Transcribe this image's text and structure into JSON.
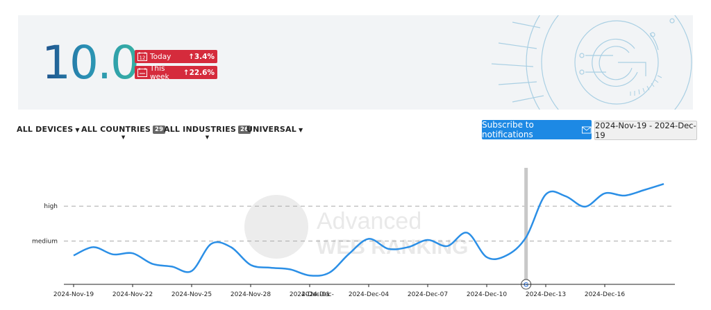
{
  "score": {
    "value": "10.0",
    "badges": [
      {
        "label": "Today",
        "delta": "↑3.4%",
        "icon": "calendar-day-icon"
      },
      {
        "label": "This week",
        "delta": "↑22.6%",
        "icon": "calendar-week-icon"
      }
    ],
    "logo_icon": "google-g-icon"
  },
  "filters": {
    "devices": {
      "label": "ALL DEVICES"
    },
    "countries": {
      "label": "ALL COUNTRIES",
      "count": "29"
    },
    "industries": {
      "label": "ALL INDUSTRIES",
      "count": "26"
    },
    "universal": {
      "label": "UNIVERSAL"
    }
  },
  "subscribe": {
    "label": "Subscribe to notifications",
    "icon": "mail-icon"
  },
  "date_range": "2024-Nov-19 - 2024-Dec-19",
  "watermark": {
    "line1": "Advanced",
    "line2": "WEB RANKING"
  },
  "colors": {
    "line": "#2b8fe6",
    "badge": "#d52b3c",
    "button": "#1d89e4"
  },
  "chart_data": {
    "type": "line",
    "y_levels": [
      "high",
      "medium"
    ],
    "x_tick_labels": [
      "2024-Nov-19",
      "2024-Nov-22",
      "2024-Nov-25",
      "2024-Nov-28",
      "2024-Dec-01",
      "2024-Dec-04",
      "2024-Dec-07",
      "2024-Dec-10",
      "2024-Dec-13",
      "2024-Dec-16",
      "2024-Dec-"
    ],
    "x_start": "2024-Nov-19",
    "x_end": "2024-Dec-19",
    "ylim": [
      0,
      10
    ],
    "grid": "dashed lines at high and medium",
    "series": [
      {
        "values": [
          [
            "2024-Nov-19",
            1.85
          ],
          [
            "2024-Nov-20",
            2.6
          ],
          [
            "2024-Nov-21",
            1.95
          ],
          [
            "2024-Nov-22",
            2.05
          ],
          [
            "2024-Nov-23",
            1.1
          ],
          [
            "2024-Nov-24",
            0.85
          ],
          [
            "2024-Nov-25",
            0.45
          ],
          [
            "2024-Nov-26",
            2.9
          ],
          [
            "2024-Nov-27",
            2.6
          ],
          [
            "2024-Nov-28",
            1.0
          ],
          [
            "2024-Nov-29",
            0.75
          ],
          [
            "2024-Nov-30",
            0.6
          ],
          [
            "2024-Dec-01",
            0.05
          ],
          [
            "2024-Dec-02",
            0.3
          ],
          [
            "2024-Dec-03",
            2.0
          ],
          [
            "2024-Dec-04",
            3.35
          ],
          [
            "2024-Dec-05",
            2.45
          ],
          [
            "2024-Dec-06",
            2.6
          ],
          [
            "2024-Dec-07",
            3.25
          ],
          [
            "2024-Dec-08",
            2.7
          ],
          [
            "2024-Dec-09",
            3.9
          ],
          [
            "2024-Dec-10",
            1.7
          ],
          [
            "2024-Dec-11",
            1.85
          ],
          [
            "2024-Dec-12",
            3.5
          ],
          [
            "2024-Dec-13",
            7.35
          ],
          [
            "2024-Dec-14",
            7.2
          ],
          [
            "2024-Dec-15",
            6.25
          ],
          [
            "2024-Dec-16",
            7.45
          ],
          [
            "2024-Dec-17",
            7.25
          ],
          [
            "2024-Dec-18",
            7.75
          ],
          [
            "2024-Dec-19",
            8.3
          ]
        ]
      }
    ],
    "marker": {
      "date": "2024-Dec-12",
      "label": "G",
      "icon": "google-update-marker-icon"
    }
  }
}
